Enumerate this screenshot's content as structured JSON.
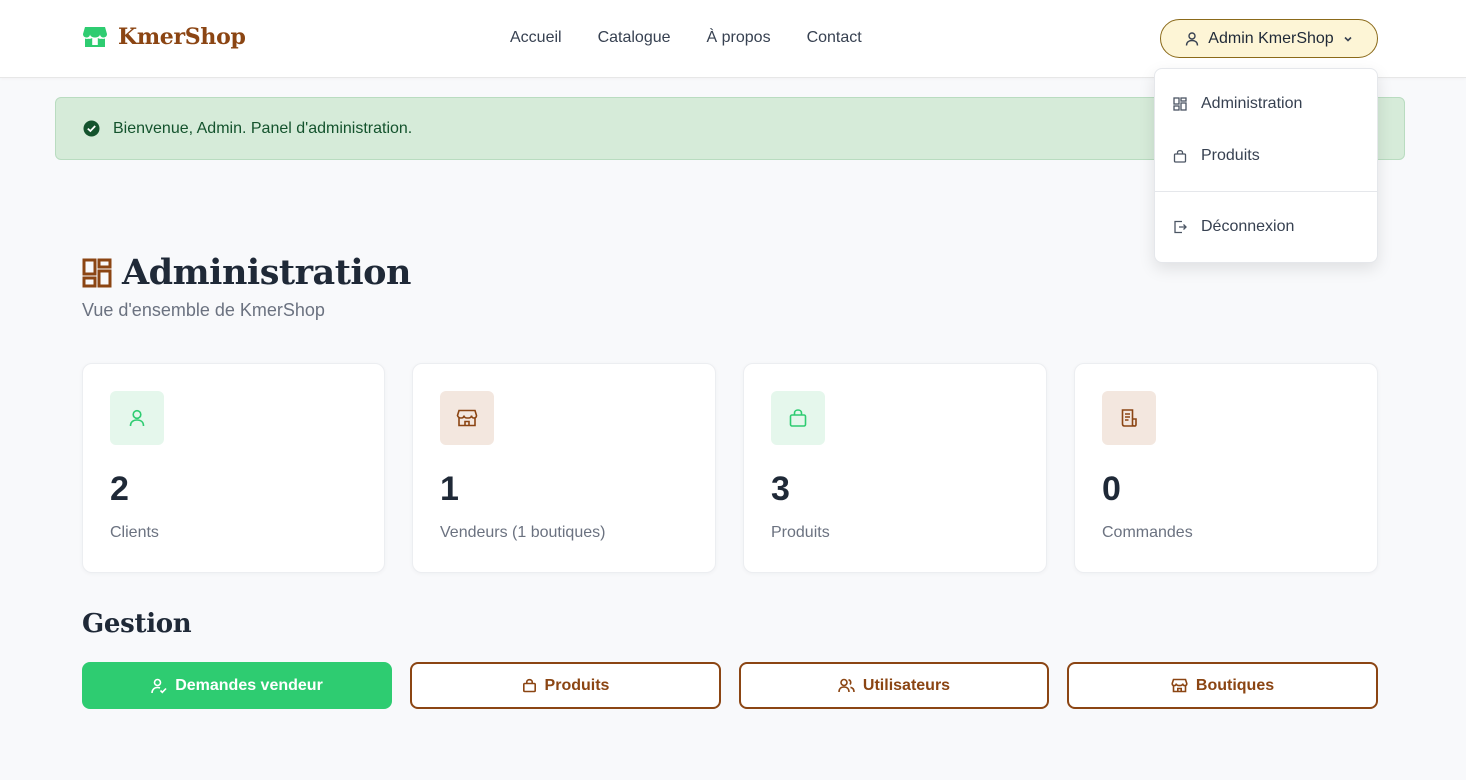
{
  "brand": {
    "name": "KmerShop"
  },
  "nav": {
    "items": [
      {
        "label": "Accueil"
      },
      {
        "label": "Catalogue"
      },
      {
        "label": "À propos"
      },
      {
        "label": "Contact"
      }
    ]
  },
  "user_menu": {
    "label": "Admin KmerShop",
    "items": [
      {
        "label": "Administration",
        "icon": "dashboard-icon"
      },
      {
        "label": "Produits",
        "icon": "shopping-bag-icon"
      },
      {
        "label": "Déconnexion",
        "icon": "logout-icon"
      }
    ]
  },
  "alert": {
    "text": "Bienvenue, Admin. Panel d'administration.",
    "icon": "check-circle-icon"
  },
  "page": {
    "title": "Administration",
    "subtitle": "Vue d'ensemble de KmerShop"
  },
  "stats": [
    {
      "value": "2",
      "label": "Clients",
      "icon": "user-icon"
    },
    {
      "value": "1",
      "label": "Vendeurs (1 boutiques)",
      "icon": "store-icon"
    },
    {
      "value": "3",
      "label": "Produits",
      "icon": "shopping-bag-icon"
    },
    {
      "value": "0",
      "label": "Commandes",
      "icon": "receipt-icon"
    }
  ],
  "gestion": {
    "title": "Gestion",
    "buttons": [
      {
        "label": "Demandes vendeur",
        "icon": "user-check-icon"
      },
      {
        "label": "Produits",
        "icon": "shopping-bag-icon"
      },
      {
        "label": "Utilisateurs",
        "icon": "users-icon"
      },
      {
        "label": "Boutiques",
        "icon": "store-icon"
      }
    ]
  },
  "colors": {
    "brand": "#8b4513",
    "green": "#2ecc71",
    "alert_bg": "#d6ebd9",
    "user_button_bg": "#fdf5d6",
    "background": "#f8f9fb"
  }
}
